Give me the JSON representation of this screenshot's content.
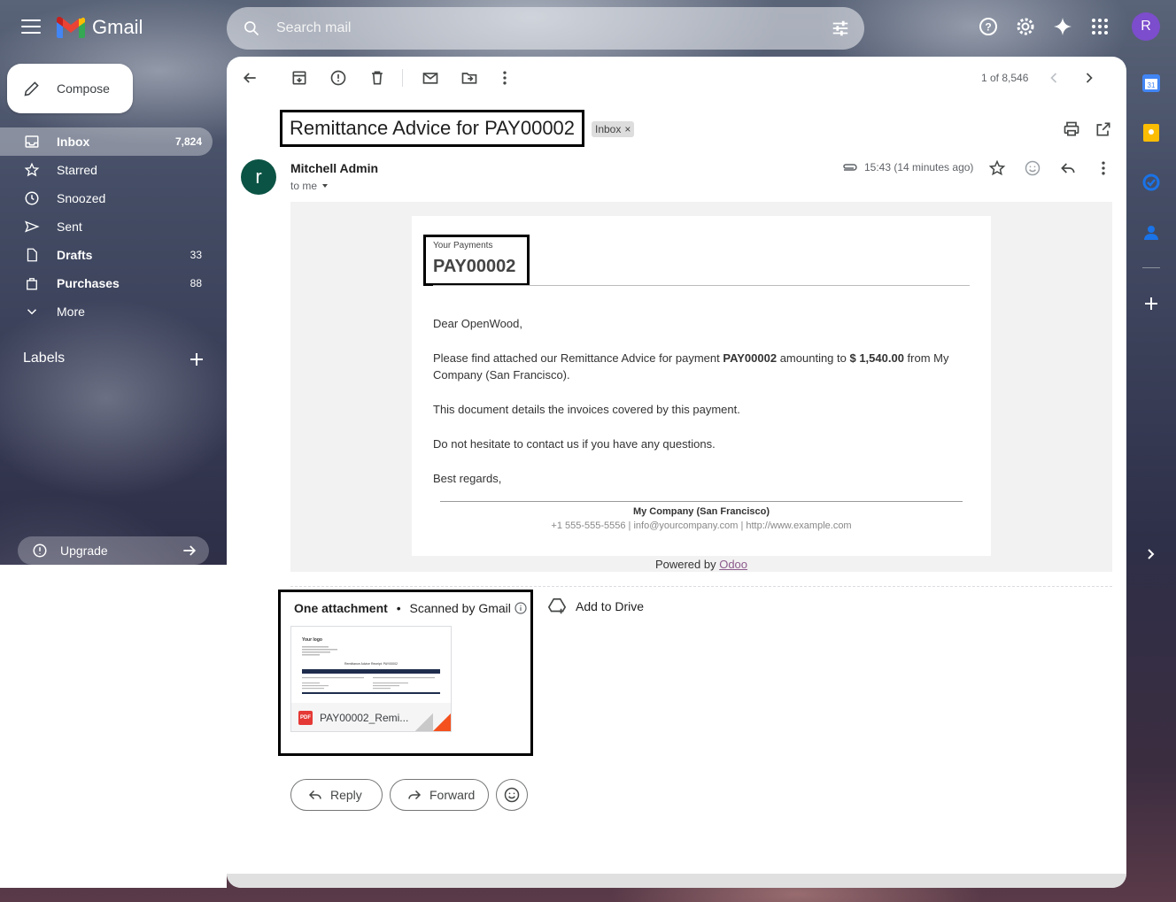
{
  "app": {
    "name": "Gmail"
  },
  "search": {
    "placeholder": "Search mail"
  },
  "compose": {
    "label": "Compose"
  },
  "nav": [
    {
      "label": "Inbox",
      "count": "7,824",
      "icon": "inbox-icon"
    },
    {
      "label": "Starred",
      "count": "",
      "icon": "star-icon"
    },
    {
      "label": "Snoozed",
      "count": "",
      "icon": "clock-icon"
    },
    {
      "label": "Sent",
      "count": "",
      "icon": "send-icon"
    },
    {
      "label": "Drafts",
      "count": "33",
      "icon": "draft-icon"
    },
    {
      "label": "Purchases",
      "count": "88",
      "icon": "bag-icon"
    },
    {
      "label": "More",
      "count": "",
      "icon": "chevron-down-icon"
    }
  ],
  "labels": {
    "heading": "Labels"
  },
  "upgrade": {
    "label": "Upgrade"
  },
  "user": {
    "initial": "R",
    "color": "#7c4dcc"
  },
  "toolbar": {
    "pager": "1 of 8,546"
  },
  "email": {
    "subject": "Remittance Advice for PAY00002",
    "label_chip": "Inbox",
    "label_chip_close": "×",
    "sender_initial": "r",
    "sender_color": "#0b5345",
    "sender": "Mitchell Admin",
    "to": "to me",
    "time": "15:43 (14 minutes ago)"
  },
  "body": {
    "header_small": "Your Payments",
    "header_big": "PAY00002",
    "greeting": "Dear OpenWood,",
    "para1_a": "Please find attached our Remittance Advice for payment ",
    "para1_b": "PAY00002",
    "para1_c": " amounting to ",
    "para1_d": "$ 1,540.00",
    "para1_e": " from My Company (San Francisco).",
    "para2": "This document details the invoices covered by this payment.",
    "para3": "Do not hesitate to contact us if you have any questions.",
    "signoff": "Best regards,",
    "company": "My Company (San Francisco)",
    "contact": "+1 555-555-5556 | info@yourcompany.com | http://www.example.com",
    "powered_prefix": "Powered by ",
    "powered_link": "Odoo"
  },
  "attachments": {
    "title": "One attachment",
    "separator": "•",
    "scanned": "Scanned by Gmail",
    "file_name": "PAY00002_Remi...",
    "file_badge": "PDF",
    "add_to_drive": "Add to Drive",
    "thumb_logo": "Your logo",
    "thumb_title": "Remittance Advice Receipt: PAY00002"
  },
  "actions": {
    "reply": "Reply",
    "forward": "Forward"
  }
}
